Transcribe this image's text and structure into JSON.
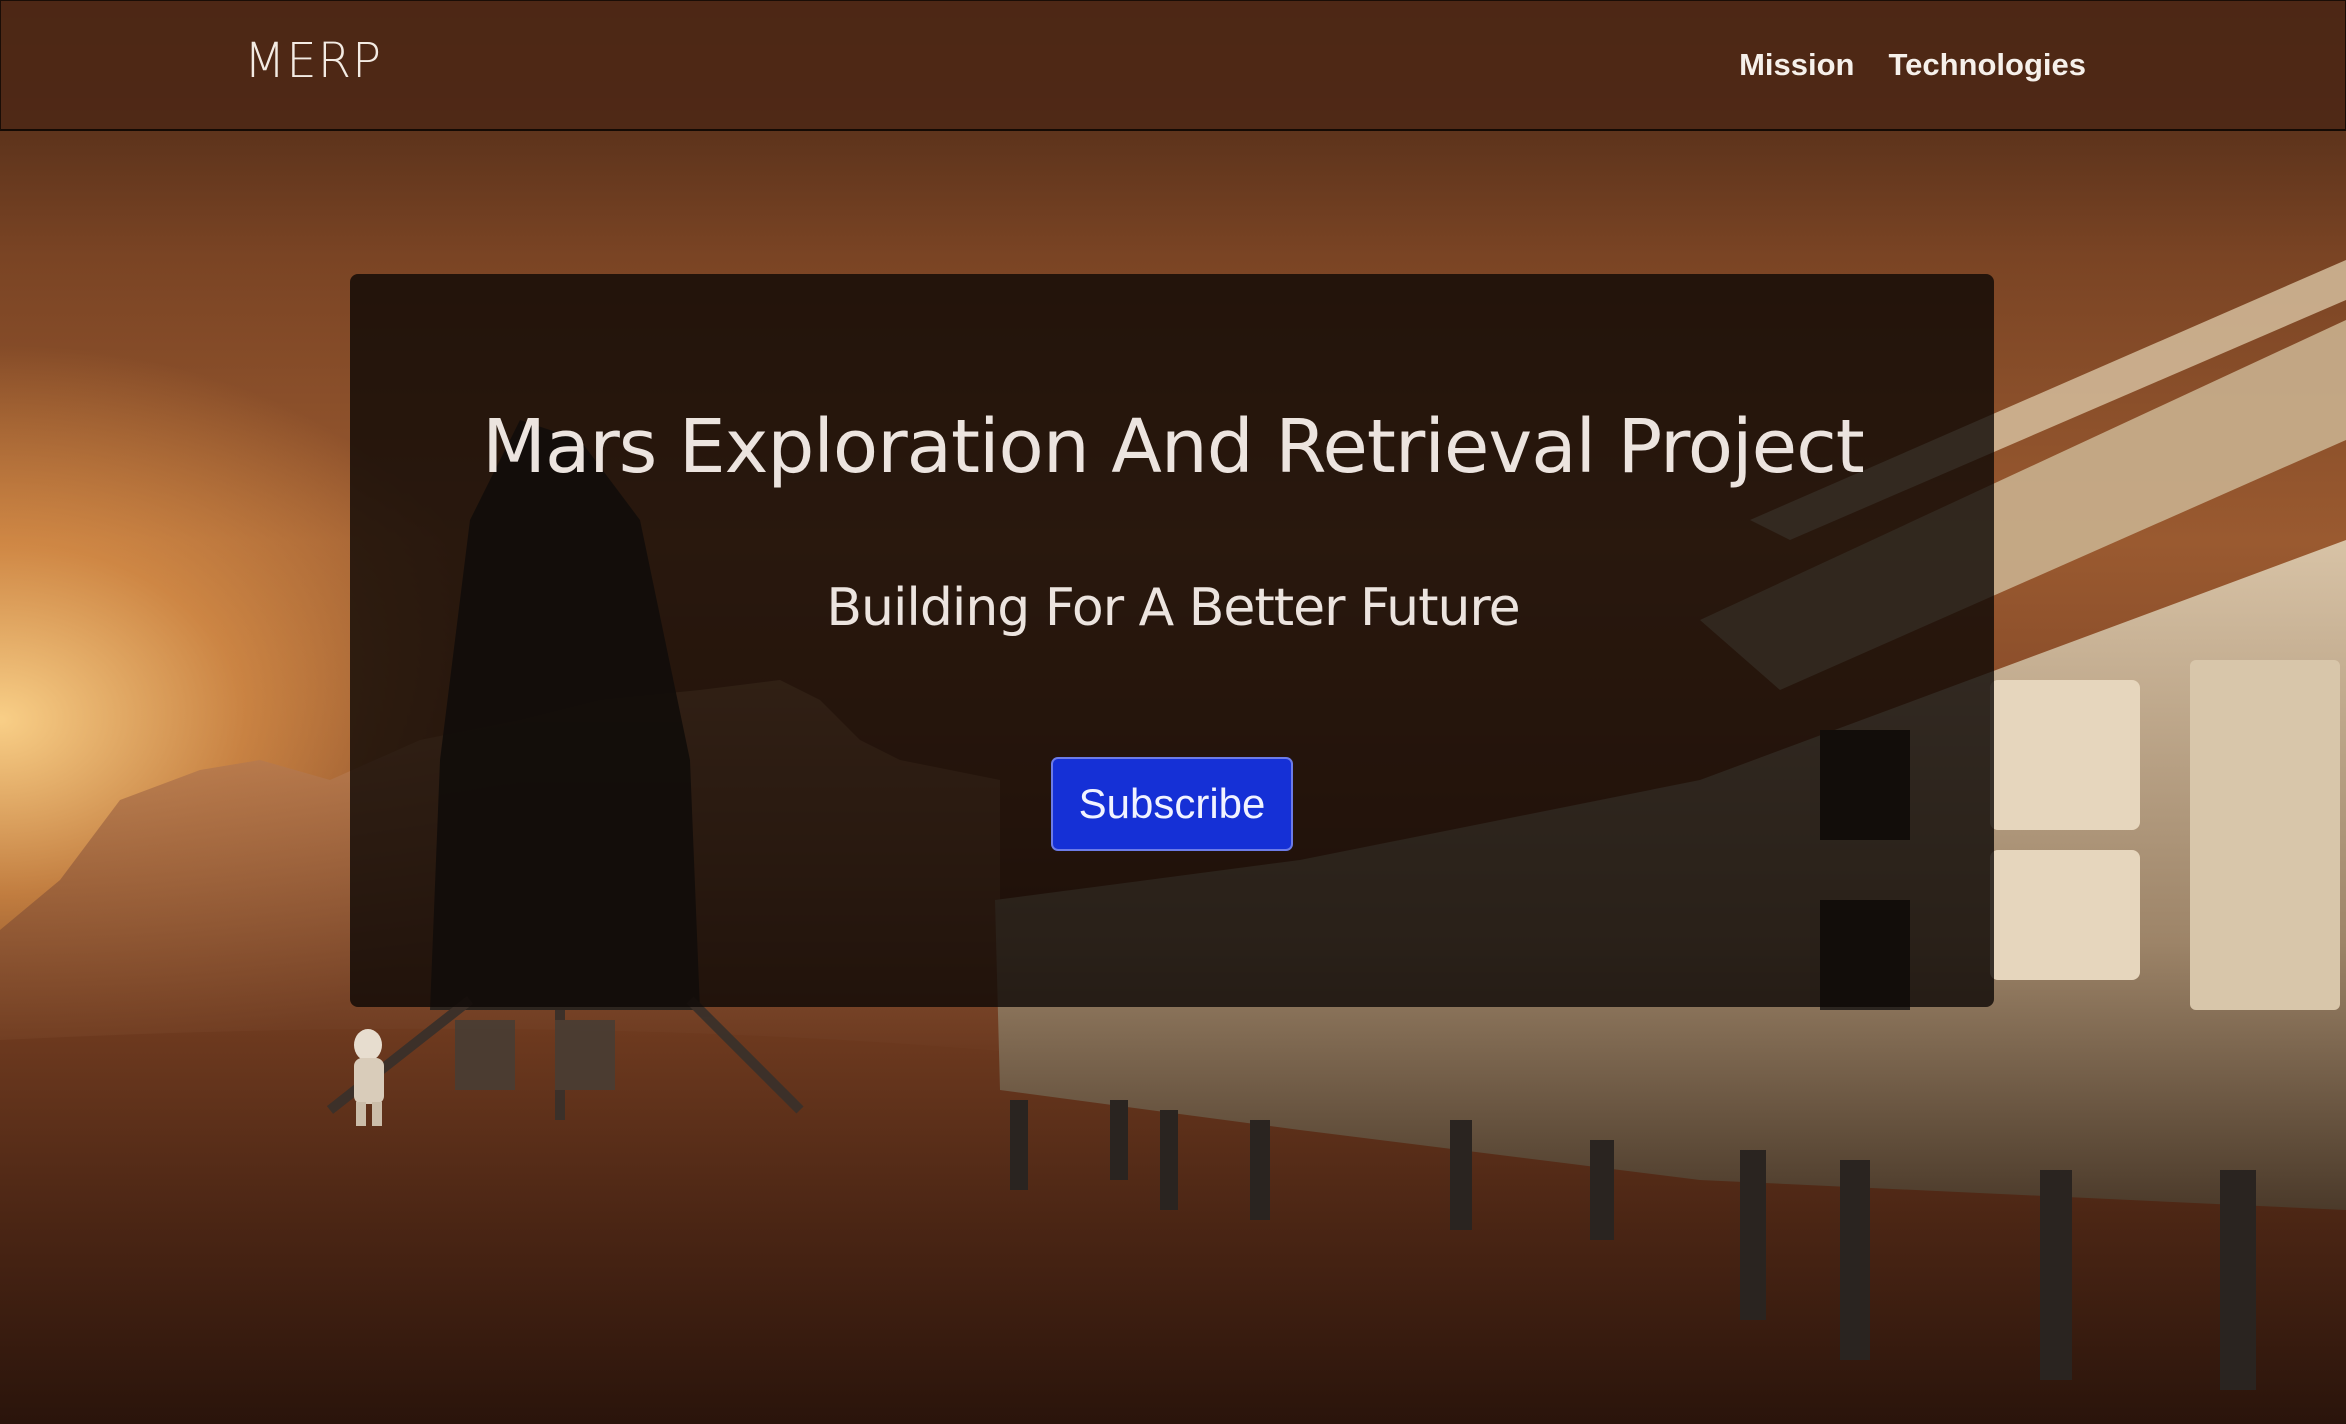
{
  "header": {
    "brand": "MERP",
    "nav": [
      {
        "label": "Mission"
      },
      {
        "label": "Technologies"
      }
    ]
  },
  "hero": {
    "title": "Mars Exploration And Retrieval Project",
    "subtitle": "Building For A Better Future",
    "subscribe_label": "Subscribe"
  },
  "colors": {
    "nav_background": "#4e2816",
    "hero_overlay": "#0c0805",
    "button": "#1530d6",
    "text": "#ece4df"
  }
}
